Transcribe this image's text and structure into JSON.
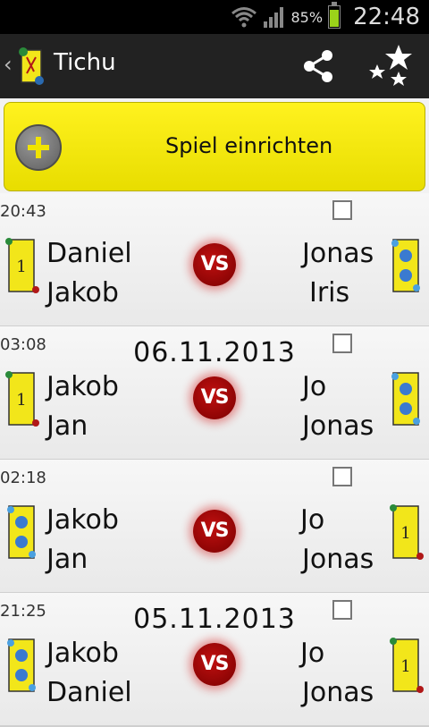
{
  "status_bar": {
    "battery": "85%",
    "time": "22:48"
  },
  "action_bar": {
    "back": "‹",
    "title": "Tichu"
  },
  "add_game": {
    "label": "Spiel einrichten"
  },
  "games": [
    {
      "time": "20:43",
      "date": "",
      "team_left": [
        "Daniel",
        "Jakob"
      ],
      "team_right": [
        "Jonas",
        "Iris"
      ],
      "vs": "VS"
    },
    {
      "time": "03:08",
      "date": "06.11.2013",
      "team_left": [
        "Jakob",
        "Jan"
      ],
      "team_right": [
        "Jo",
        "Jonas"
      ],
      "vs": "VS"
    },
    {
      "time": "02:18",
      "date": "",
      "team_left": [
        "Jakob",
        "Jan"
      ],
      "team_right": [
        "Jo",
        "Jonas"
      ],
      "vs": "VS"
    },
    {
      "time": "21:25",
      "date": "05.11.2013",
      "team_left": [
        "Jakob",
        "Daniel"
      ],
      "team_right": [
        "Jo",
        "Jonas"
      ],
      "vs": "VS"
    }
  ]
}
